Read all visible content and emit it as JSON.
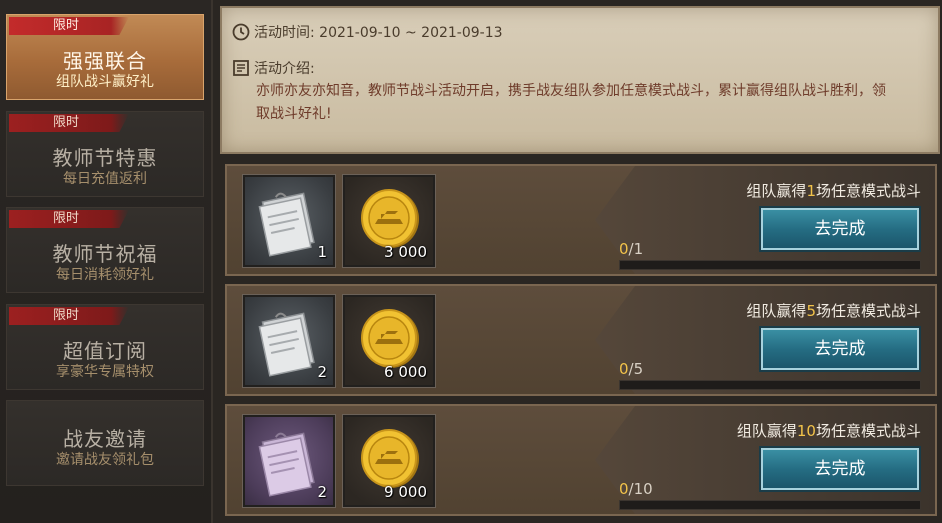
{
  "sidebar": {
    "items": [
      {
        "badge": "限时",
        "title": "强强联合",
        "sub": "组队战斗赢好礼",
        "active": true
      },
      {
        "badge": "限时",
        "title": "教师节特惠",
        "sub": "每日充值返利",
        "active": false
      },
      {
        "badge": "限时",
        "title": "教师节祝福",
        "sub": "每日消耗领好礼",
        "active": false
      },
      {
        "badge": "限时",
        "title": "超值订阅",
        "sub": "享豪华专属特权",
        "active": false
      },
      {
        "badge": "",
        "title": "战友邀请",
        "sub": "邀请战友领礼包",
        "active": false
      }
    ]
  },
  "info": {
    "time_label": "活动时间: 2021-09-10 ~ 2021-09-13",
    "intro_label": "活动介绍:",
    "intro_text": "亦师亦友亦知音，教师节战斗活动开启，携手战友组队参加任意模式战斗，累计赢得组队战斗胜利，领取战斗好礼!"
  },
  "tasks": [
    {
      "title_pre": "组队赢得",
      "title_num": "1",
      "title_post": "场任意模式战斗",
      "items": [
        {
          "icon": "gray-document-icon",
          "count": "1"
        },
        {
          "icon": "gold-coin-icon",
          "count": "3 000"
        }
      ],
      "button": "去完成",
      "progress_cur": "0",
      "progress_total": "/1",
      "progress": 0
    },
    {
      "title_pre": "组队赢得",
      "title_num": "5",
      "title_post": "场任意模式战斗",
      "items": [
        {
          "icon": "gray-document-icon",
          "count": "2"
        },
        {
          "icon": "gold-coin-icon",
          "count": "6 000"
        }
      ],
      "button": "去完成",
      "progress_cur": "0",
      "progress_total": "/5",
      "progress": 0
    },
    {
      "title_pre": "组队赢得",
      "title_num": "10",
      "title_post": "场任意模式战斗",
      "items": [
        {
          "icon": "purple-document-icon",
          "count": "2"
        },
        {
          "icon": "gold-coin-icon",
          "count": "9 000"
        }
      ],
      "button": "去完成",
      "progress_cur": "0",
      "progress_total": "/10",
      "progress": 0
    }
  ],
  "colors": {
    "accent": "#f2c34a",
    "button": "#256d83",
    "badge": "#9c2020",
    "active_tab": "#a86c3b"
  }
}
